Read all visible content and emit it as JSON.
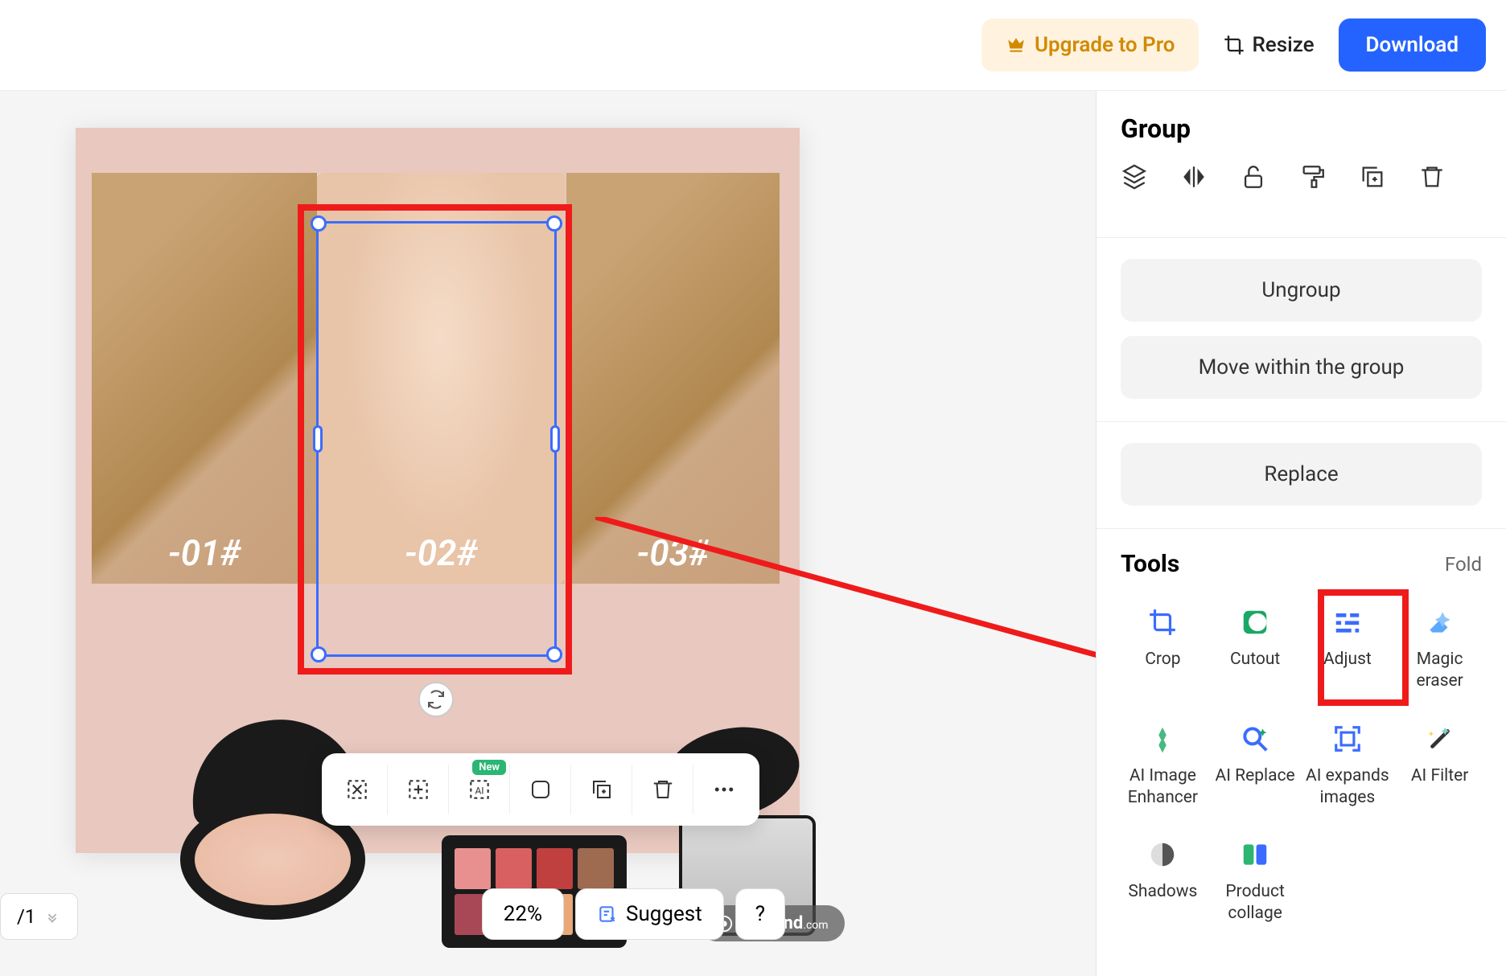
{
  "topbar": {
    "upgrade": "Upgrade to Pro",
    "resize": "Resize",
    "download": "Download"
  },
  "canvas": {
    "photos": [
      {
        "label": "-01#"
      },
      {
        "label": "-02#"
      },
      {
        "label": "-03#"
      }
    ],
    "watermark": "insMind",
    "watermark_suffix": ".com",
    "floating_toolbar": {
      "new_badge": "New"
    }
  },
  "bottom": {
    "page": "/1",
    "zoom": "22%",
    "suggest": "Suggest",
    "help": "?"
  },
  "panel": {
    "title": "Group",
    "actions": {
      "ungroup": "Ungroup",
      "move": "Move within the group",
      "replace": "Replace"
    },
    "tools_title": "Tools",
    "fold": "Fold",
    "tools": [
      {
        "key": "crop",
        "label": "Crop"
      },
      {
        "key": "cutout",
        "label": "Cutout"
      },
      {
        "key": "adjust",
        "label": "Adjust"
      },
      {
        "key": "magic-eraser",
        "label": "Magic eraser"
      },
      {
        "key": "ai-enhancer",
        "label": "AI Image Enhancer"
      },
      {
        "key": "ai-replace",
        "label": "AI Replace"
      },
      {
        "key": "ai-expand",
        "label": "AI expands images"
      },
      {
        "key": "ai-filter",
        "label": "AI Filter"
      },
      {
        "key": "shadows",
        "label": "Shadows"
      },
      {
        "key": "product-collage",
        "label": "Product collage"
      }
    ]
  },
  "palette_colors": [
    "#e89090",
    "#d86060",
    "#c04040",
    "#9e6a50",
    "#a84856",
    "#d87858",
    "#e8a878",
    "#c89060"
  ]
}
